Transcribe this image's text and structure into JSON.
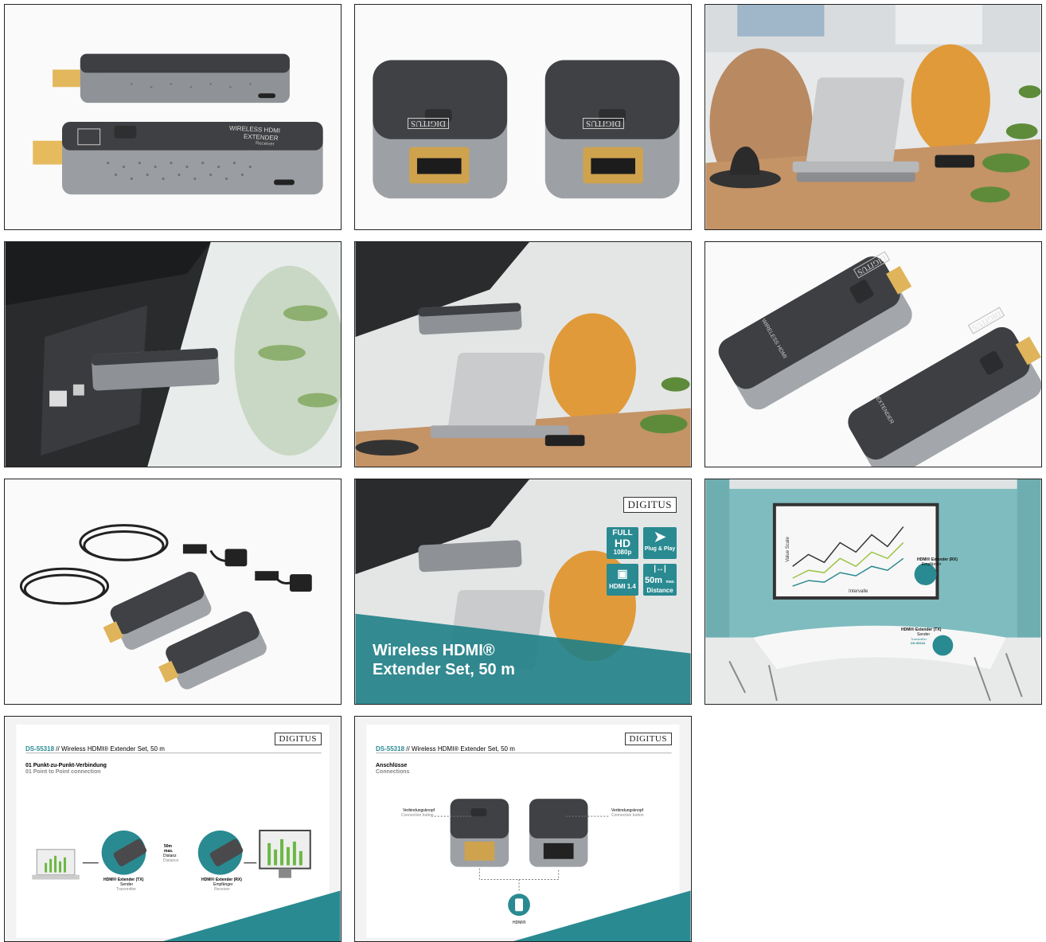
{
  "gallery": {
    "tiles": [
      {
        "name": "product-side-view",
        "texts": {
          "line1": "WIRELESS HDMI",
          "line2": "EXTENDER",
          "line3": "Receiver"
        }
      },
      {
        "name": "product-front-view",
        "texts": {
          "brand1": "DIGITUS",
          "brand2": "DIGITUS"
        }
      },
      {
        "name": "office-desk-scene"
      },
      {
        "name": "tv-plugged-closeup"
      },
      {
        "name": "tv-desk-scene"
      },
      {
        "name": "product-top-view",
        "texts": {
          "brand1": "DIGITUS",
          "brand2": "DIGITUS",
          "label1": "WIRELESS HDMI",
          "label2": "EXTENDER"
        }
      },
      {
        "name": "accessories-set"
      },
      {
        "name": "marketing-banner",
        "texts": {
          "logo": "DIGITUS",
          "full": "FULL",
          "hd": "HD",
          "res": "1080p",
          "plug": "Plug & Play",
          "hdmi": "HDMI 1.4",
          "dist": "50m",
          "dist_max": "max.",
          "distance": "Distance",
          "title1": "Wireless HDMI®",
          "title2": "Extender Set, 50 m"
        }
      },
      {
        "name": "conference-room-scene",
        "texts": {
          "yaxis": "Value Scale",
          "xaxis": "Intervalle",
          "rx_title": "HDMI® Extender (RX)",
          "rx_sub": "Empfänger",
          "rx_sub2": "Receiver",
          "rx_model": "DS-55318",
          "tx_title": "HDMI® Extender (TX)",
          "tx_sub": "Sender",
          "tx_sub2": "Transmitter",
          "tx_model": "DS-55318"
        }
      },
      {
        "name": "datasheet-connection",
        "texts": {
          "logo": "DIGITUS",
          "model": "DS-55318",
          "sep": "//",
          "product": "Wireless HDMI® Extender Set, 50 m",
          "sec_de": "01 Punkt-zu-Punkt-Verbindung",
          "sec_en": "01 Point to Point connection",
          "dist1": "50m",
          "dist2": "max.",
          "dist3": "Distanz",
          "dist4": "Distance",
          "tx_title": "HDMI® Extender (TX)",
          "tx_sub": "Sender",
          "tx_sub2": "Transmitter",
          "rx_title": "HDMI® Extender (RX)",
          "rx_sub": "Empfänger",
          "rx_sub2": "Receiver"
        }
      },
      {
        "name": "datasheet-ports",
        "texts": {
          "logo": "DIGITUS",
          "model": "DS-55318",
          "sep": "//",
          "product": "Wireless HDMI® Extender Set, 50 m",
          "sec_de": "Anschlüsse",
          "sec_en": "Connections",
          "btn_de_l": "Verbindungsknopf",
          "btn_en_l": "Connection button",
          "btn_de_r": "Verbindungsknopf",
          "btn_en_r": "Connection button",
          "hdmi": "HDMI®"
        }
      }
    ]
  },
  "colors": {
    "teal": "#2a8a91",
    "device": "#4a4a4c",
    "metal": "#9a9ea2"
  }
}
